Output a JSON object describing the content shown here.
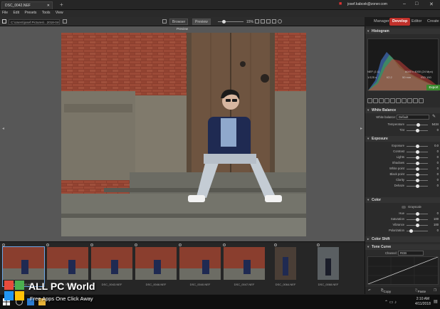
{
  "titlebar": {
    "tab_title": "DSC_0042.NEF",
    "account": "josef.kabcek@zoner.com"
  },
  "menu": [
    "File",
    "Edit",
    "Presets",
    "Tools",
    "View"
  ],
  "modules": {
    "items": [
      "Manager",
      "Develop",
      "Editor",
      "Create"
    ],
    "active": "Develop"
  },
  "toolbar": {
    "path": "C:\\Users\\josef.Pictures\\...2018-04-06 ...",
    "browser_label": "Browser",
    "preview_label": "Preview",
    "zoom": "15%"
  },
  "viewer": {
    "title": "Preview"
  },
  "filmstrip": {
    "items": [
      {
        "name": "DSC_0042.NEF",
        "orient": "landscape"
      },
      {
        "name": "DSC_0042.NEF",
        "orient": "landscape"
      },
      {
        "name": "DSC_0043.NEF",
        "orient": "landscape"
      },
      {
        "name": "DSC_0046.NEF",
        "orient": "landscape"
      },
      {
        "name": "DSC_0040.NEF",
        "orient": "landscape"
      },
      {
        "name": "DSC_0047.NEF",
        "orient": "landscape"
      },
      {
        "name": "DSC_0064.NEF",
        "orient": "portrait"
      },
      {
        "name": "DSC_0068.NEF",
        "orient": "portrait"
      }
    ]
  },
  "histogram": {
    "title": "Histogram",
    "format": "NEF",
    "ratio": "(1:1)",
    "resolution": "6000 x 4000 (24 Mpx)",
    "shutter": "1/125 s",
    "aperture": "f/2.2",
    "focal": "50 mm",
    "iso": "ISO 100",
    "export_label": "Export"
  },
  "white_balance": {
    "title": "White Balance",
    "mode_label": "White balance:",
    "mode_value": "Default",
    "rows": [
      {
        "label": "Temperature",
        "value": "5434",
        "pos": 0.55
      },
      {
        "label": "Tint",
        "value": "0",
        "pos": 0.5
      }
    ]
  },
  "exposure": {
    "title": "Exposure",
    "rows": [
      {
        "label": "Exposure",
        "value": "0.0",
        "pos": 0.5
      },
      {
        "label": "Contrast",
        "value": "0",
        "pos": 0.5
      },
      {
        "label": "Lights",
        "value": "0",
        "pos": 0.5
      },
      {
        "label": "Shadows",
        "value": "0",
        "pos": 0.5
      },
      {
        "label": "White point",
        "value": "0",
        "pos": 0.5
      },
      {
        "label": "Black point",
        "value": "0",
        "pos": 0.5
      },
      {
        "label": "Clarity",
        "value": "0",
        "pos": 0.5
      },
      {
        "label": "Dehaze",
        "value": "0",
        "pos": 0.5
      }
    ]
  },
  "color": {
    "title": "Color",
    "grayscale_label": "Grayscale",
    "rows": [
      {
        "label": "Hue",
        "value": "0",
        "pos": 0.5
      },
      {
        "label": "Saturation",
        "value": "100",
        "pos": 0.5
      },
      {
        "label": "Vibrance",
        "value": "100",
        "pos": 0.5
      },
      {
        "label": "Polarization",
        "value": "0",
        "pos": 0.2
      }
    ]
  },
  "color_shift": {
    "title": "Color Shift"
  },
  "tone_curve": {
    "title": "Tone Curve",
    "channel_label": "Channel:",
    "channel_value": "RGB"
  },
  "actions": {
    "copy_label": "Copy",
    "paste_label": "Paste"
  },
  "taskbar": {
    "time": "2:10 AM",
    "date": "4/11/2018"
  },
  "watermark": {
    "title": "ALL PC World",
    "subtitle": "Free Apps One Click Away"
  },
  "colors": {
    "accent": "#c0312b",
    "export": "#3a8a2d",
    "panel": "#2b2b2b",
    "viewer_bg": "#575757"
  }
}
